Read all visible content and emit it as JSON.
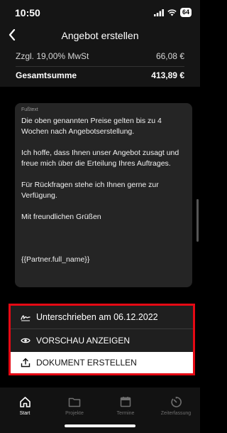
{
  "status": {
    "time": "10:50",
    "battery": "64"
  },
  "nav": {
    "title": "Angebot erstellen"
  },
  "summary": {
    "tax_label": "Zzgl. 19,00% MwSt",
    "tax_value": "66,08 €",
    "total_label": "Gesamtsumme",
    "total_value": "413,89 €"
  },
  "footer": {
    "label": "Fußtext",
    "text": "Die oben genannten Preise gelten bis zu 4 Wochen nach Angebotserstellung.\n\nIch hoffe, dass Ihnen unser Angebot zusagt und freue mich über die Erteilung Ihres Auftrages.\n\nFür Rückfragen stehe ich Ihnen gerne zur Verfügung.\n\nMit freundlichen Grüßen\n\n\n\n{{Partner.full_name}}"
  },
  "actions": {
    "signed": "Unterschrieben am 06.12.2022",
    "preview": "VORSCHAU ANZEIGEN",
    "create": "DOKUMENT ERSTELLEN"
  },
  "tabs": [
    {
      "label": "Start",
      "icon": "home-icon"
    },
    {
      "label": "Projekte",
      "icon": "folder-icon"
    },
    {
      "label": "Termine",
      "icon": "calendar-icon"
    },
    {
      "label": "Zeiterfassung",
      "icon": "timer-icon"
    }
  ],
  "colors": {
    "highlight": "#e50914",
    "background": "#000000",
    "card": "#252525"
  }
}
